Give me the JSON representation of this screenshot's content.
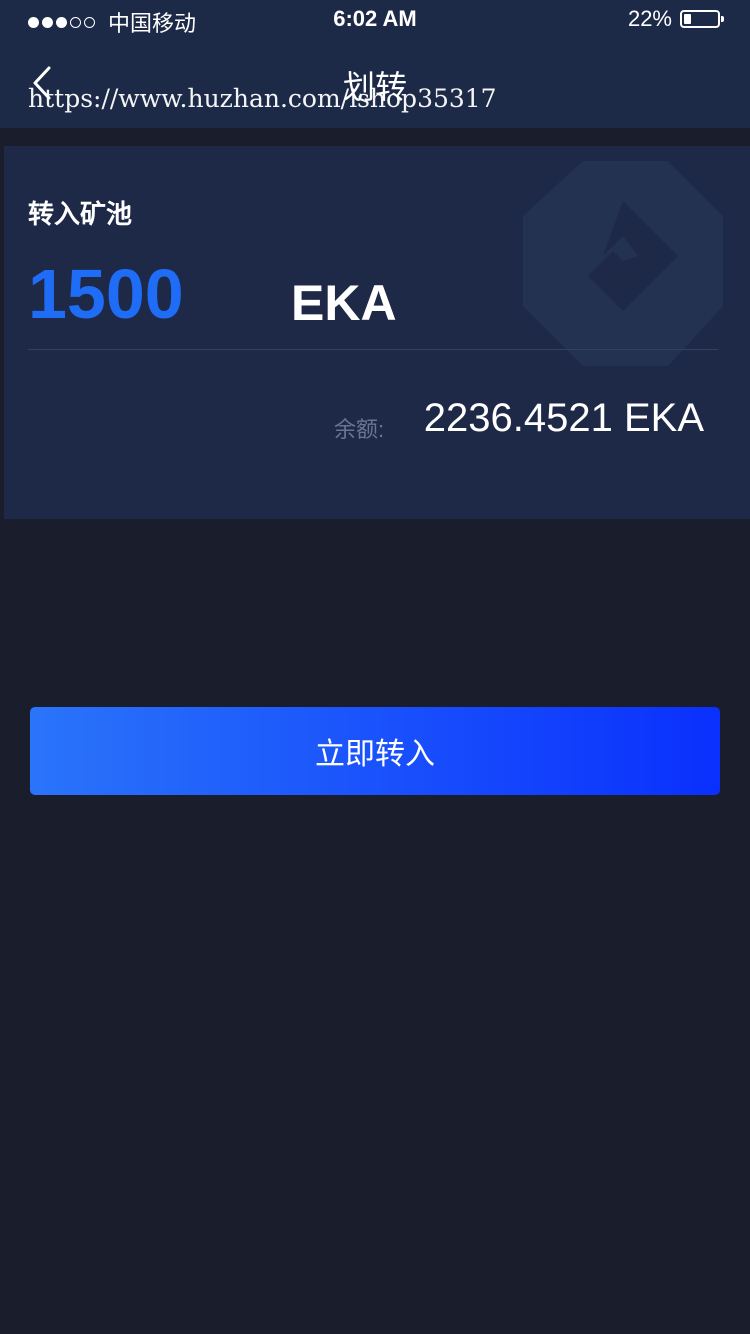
{
  "status_bar": {
    "carrier": "中国移动",
    "time": "6:02 AM",
    "battery_percent": "22%",
    "battery_level": 0.22,
    "signal_bars_filled": 3,
    "signal_bars_total": 5
  },
  "nav": {
    "title": "划转",
    "back_icon": "chevron-left-icon"
  },
  "watermark": "https://www.huzhan.com/ishop35317",
  "card": {
    "label": "转入矿池",
    "amount": "1500",
    "unit": "EKA",
    "balance_label": "余额:",
    "balance_value": "2236.4521 EKA",
    "logo_icon": "brand-logo-icon"
  },
  "action": {
    "submit_label": "立即转入"
  },
  "colors": {
    "background": "#1a1e2c",
    "header": "#1d2a47",
    "card": "#1e2947",
    "accent": "#1f6cf7",
    "button_start": "#2a74fa",
    "button_end": "#0a30fd"
  }
}
